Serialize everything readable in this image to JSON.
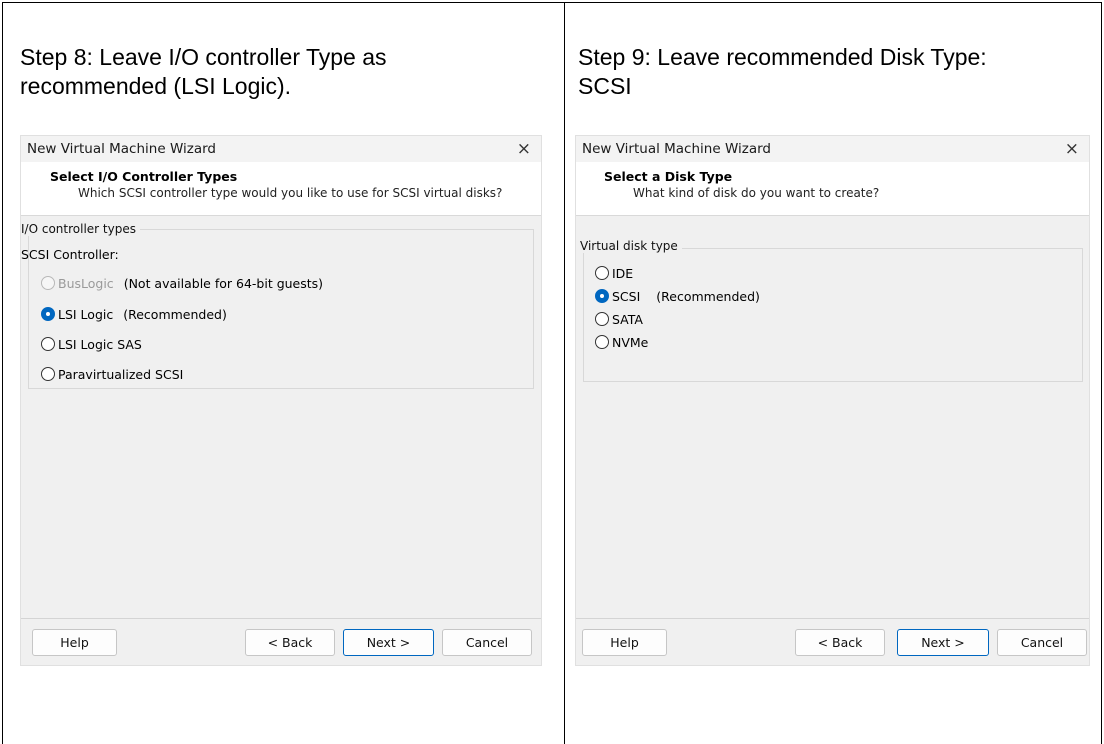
{
  "left": {
    "heading_line1": "Step 8: Leave I/O controller Type as",
    "heading_line2": "recommended (LSI Logic).",
    "wizard": {
      "window_title": "New Virtual Machine Wizard",
      "close_glyph": "×",
      "header_title": "Select I/O Controller Types",
      "header_subtitle": "Which SCSI controller type would you like to use for SCSI virtual disks?",
      "group_label": "I/O controller types",
      "controller_label": "SCSI Controller:",
      "options": [
        {
          "label": "BusLogic",
          "note": "(Not available for 64-bit guests)",
          "state": "disabled"
        },
        {
          "label": "LSI Logic",
          "note": "(Recommended)",
          "state": "checked"
        },
        {
          "label": "LSI Logic SAS",
          "note": "",
          "state": "unchecked"
        },
        {
          "label": "Paravirtualized SCSI",
          "note": "",
          "state": "unchecked"
        }
      ],
      "buttons": {
        "help": "Help",
        "back": "< Back",
        "next": "Next >",
        "cancel": "Cancel"
      }
    }
  },
  "right": {
    "heading_line1": "Step 9: Leave recommended Disk Type:",
    "heading_line2": "SCSI",
    "wizard": {
      "window_title": "New Virtual Machine Wizard",
      "close_glyph": "×",
      "header_title": "Select a Disk Type",
      "header_subtitle": "What kind of disk do you want to create?",
      "group_label": "Virtual disk type",
      "options": [
        {
          "label": "IDE",
          "note": "",
          "state": "unchecked"
        },
        {
          "label": "SCSI",
          "note": "(Recommended)",
          "state": "checked"
        },
        {
          "label": "SATA",
          "note": "",
          "state": "unchecked"
        },
        {
          "label": "NVMe",
          "note": "",
          "state": "unchecked"
        }
      ],
      "buttons": {
        "help": "Help",
        "back": "< Back",
        "next": "Next >",
        "cancel": "Cancel"
      }
    }
  },
  "colors": {
    "accent": "#0067c0",
    "dialog_bg": "#f0f0f0",
    "header_bg": "#ffffff"
  }
}
